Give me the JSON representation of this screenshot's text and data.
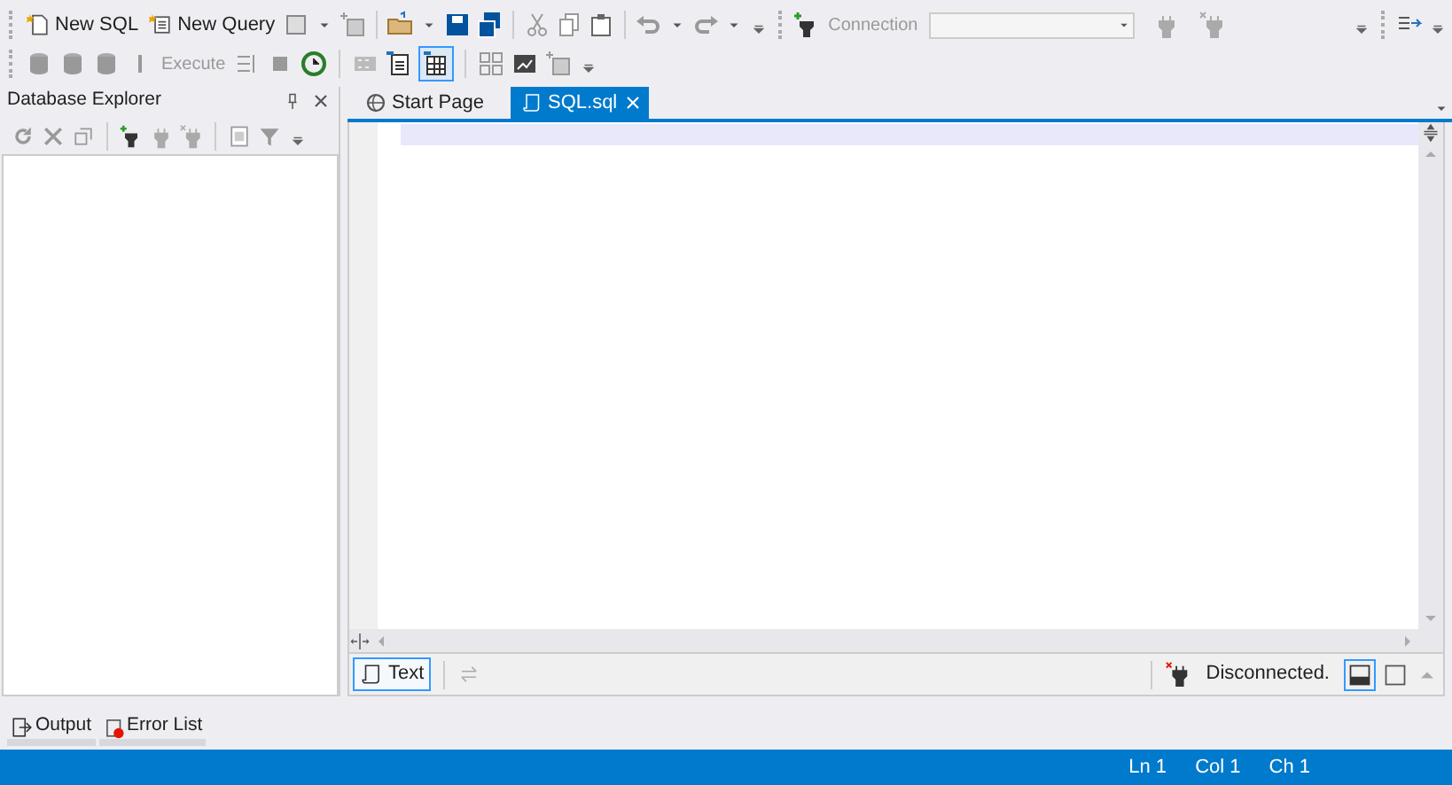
{
  "toolbar_1": {
    "buttons": [
      {
        "label": "New SQL"
      },
      {
        "label": "New Query"
      }
    ],
    "connection": {
      "label": "Connection",
      "disabled": true
    }
  },
  "toolbar_2": {
    "execute": {
      "label": "Execute",
      "disabled": true
    }
  },
  "database_explorer": {
    "title": "Database Explorer"
  },
  "tabs": [
    {
      "label": "Start Page",
      "selected": false
    },
    {
      "label": "SQL.sql",
      "selected": true
    }
  ],
  "editor_footer": {
    "view_button": {
      "label": "Text",
      "selected": true
    },
    "connection_status": "Disconnected."
  },
  "bottom_tabs": [
    {
      "label": "Output"
    },
    {
      "label": "Error List"
    }
  ],
  "status_bar": [
    "Ln 1",
    "Col 1",
    "Ch 1"
  ]
}
